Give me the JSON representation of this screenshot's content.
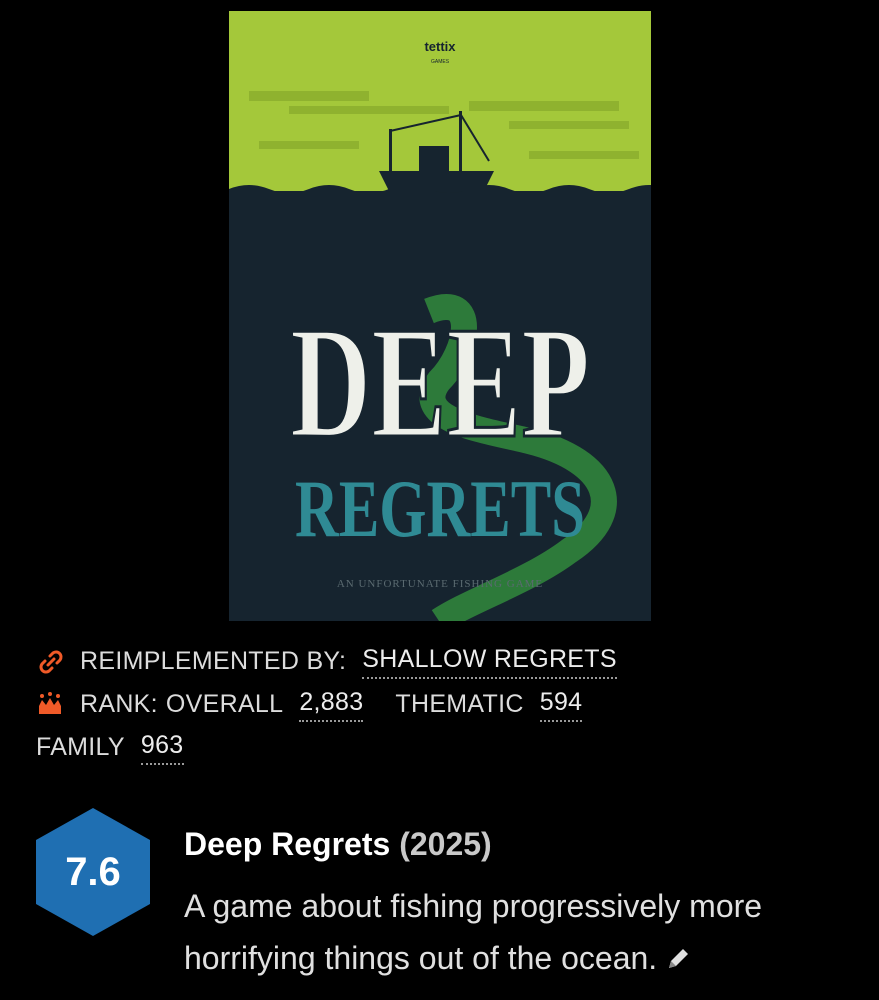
{
  "cover": {
    "publisher_logo": "tettix",
    "publisher_sub": "GAMES",
    "title_line1": "DEEP",
    "title_line2": "REGRETS",
    "tagline": "AN UNFORTUNATE FISHING GAME",
    "colors": {
      "sky": "#a4c83a",
      "sea": "#16242f",
      "title_white": "#eef0ea",
      "title_teal": "#2f8a94",
      "tentacle": "#2d7a3a"
    }
  },
  "meta": {
    "reimplemented_label": "REIMPLEMENTED BY:",
    "reimplemented_value": "SHALLOW REGRETS",
    "rank_label": "RANK:",
    "overall_label": "OVERALL",
    "overall_value": "2,883",
    "thematic_label": "THEMATIC",
    "thematic_value": "594",
    "family_label": "FAMILY",
    "family_value": "963",
    "link_icon_color": "#f05a28",
    "crown_icon_color": "#f05a28"
  },
  "game": {
    "rating": "7.6",
    "rating_color": "#1f6fb2",
    "title": "Deep Regrets",
    "year": "(2025)",
    "description": "A game about fishing progressively more horrifying things out of the ocean."
  }
}
